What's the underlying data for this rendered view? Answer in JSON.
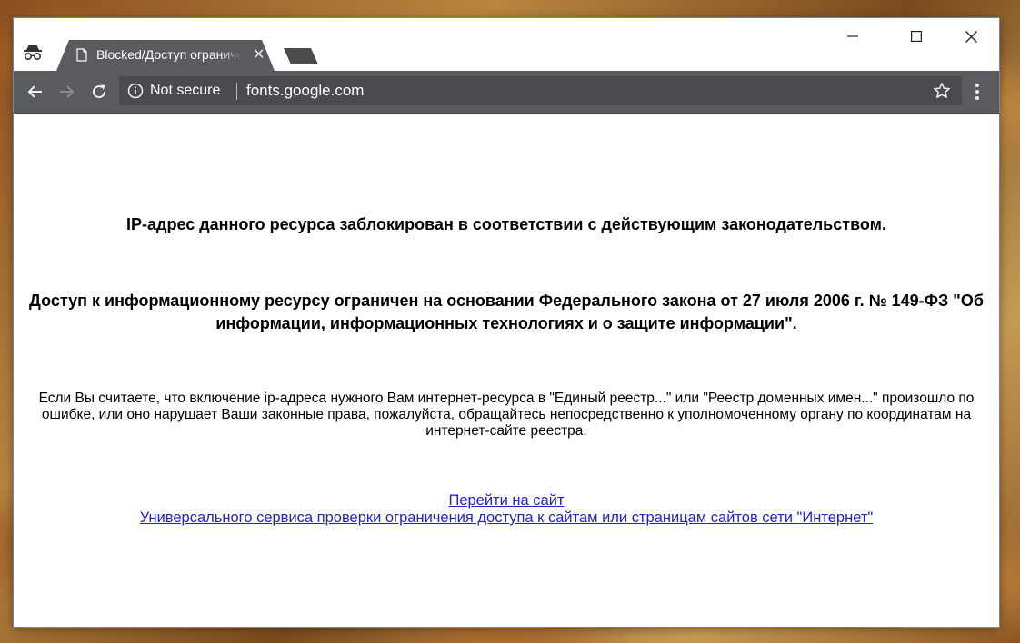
{
  "browser": {
    "tab": {
      "title": "Blocked/Доступ ограничен",
      "close_glyph": "✕"
    },
    "window_controls": {
      "minimize": "—",
      "maximize": "☐",
      "close": "✕"
    },
    "omnibox": {
      "security_text": "Not secure",
      "url": "fonts.google.com"
    },
    "icons": [
      "incognito-icon",
      "page-icon",
      "back-arrow-icon",
      "forward-arrow-icon",
      "reload-icon",
      "info-icon",
      "star-icon",
      "menu-icon"
    ],
    "colors": {
      "toolbar": "#595b5e",
      "omnibox": "#4a4b4e",
      "link": "#2323c8"
    }
  },
  "page": {
    "heading1": "IP-адрес данного ресурса заблокирован в соответствии с действующим законодательством.",
    "heading2": "Доступ к информационному ресурсу ограничен на основании Федерального закона от 27 июля 2006 г. № 149-ФЗ \"Об информации, информационных технологиях и о защите информации\".",
    "paragraph": "Если Вы считаете, что включение ip-адреса нужного Вам интернет-ресурса в \"Единый реестр...\" или \"Реестр доменных имен...\" произошло по ошибке, или оно нарушает Ваши законные права, пожалуйста, обращайтесь непосредственно к уполномоченному органу по координатам на интернет-сайте реестра.",
    "link1": "Перейти на сайт",
    "link2": "Универсального сервиса проверки ограничения доступа к сайтам или страницам сайтов сети \"Интернет\""
  }
}
